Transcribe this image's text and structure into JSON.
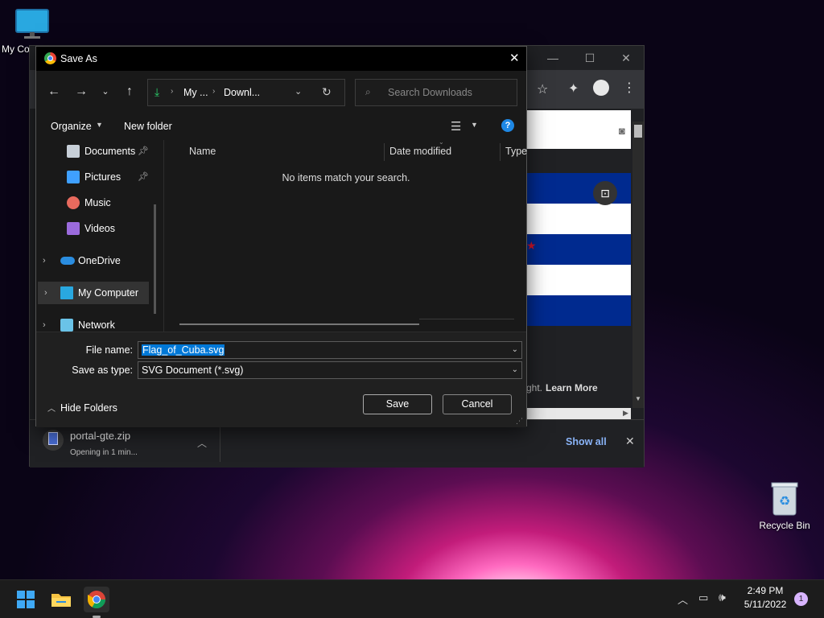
{
  "desktop": {
    "icons": [
      {
        "label": "My Co",
        "icon": "monitor-icon"
      },
      {
        "label": "Recycle Bin",
        "icon": "recycle-bin-icon"
      }
    ]
  },
  "chrome": {
    "page_text": "ght.",
    "learn_more": "Learn More",
    "download": {
      "filename": "portal-gte.zip",
      "status": "Opening in 1 min..."
    },
    "show_all": "Show all",
    "flag_colors": {
      "blue": "#002a8f",
      "white": "#ffffff",
      "red": "#cf142b"
    }
  },
  "dialog": {
    "title": "Save As",
    "breadcrumb": [
      "My ...",
      "Downl..."
    ],
    "search_placeholder": "Search Downloads",
    "organize": "Organize",
    "new_folder": "New folder",
    "nav_tree": [
      {
        "label": "Documents",
        "icon": "documents-icon",
        "pinned": true
      },
      {
        "label": "Pictures",
        "icon": "pictures-icon",
        "pinned": true
      },
      {
        "label": "Music",
        "icon": "music-icon",
        "pinned": false
      },
      {
        "label": "Videos",
        "icon": "videos-icon",
        "pinned": false
      },
      {
        "label": "OneDrive",
        "icon": "onedrive-icon",
        "expandable": true
      },
      {
        "label": "My Computer",
        "icon": "computer-icon",
        "expandable": true,
        "selected": true
      },
      {
        "label": "Network",
        "icon": "network-icon",
        "expandable": true
      }
    ],
    "columns": [
      "Name",
      "Date modified",
      "Type"
    ],
    "empty_message": "No items match your search.",
    "file_name_label": "File name:",
    "file_name_value": "Flag_of_Cuba.svg",
    "save_as_type_label": "Save as type:",
    "save_as_type_value": "SVG Document (*.svg)",
    "hide_folders": "Hide Folders",
    "save": "Save",
    "cancel": "Cancel"
  },
  "taskbar": {
    "time": "2:49 PM",
    "date": "5/11/2022",
    "notification_count": "1"
  }
}
